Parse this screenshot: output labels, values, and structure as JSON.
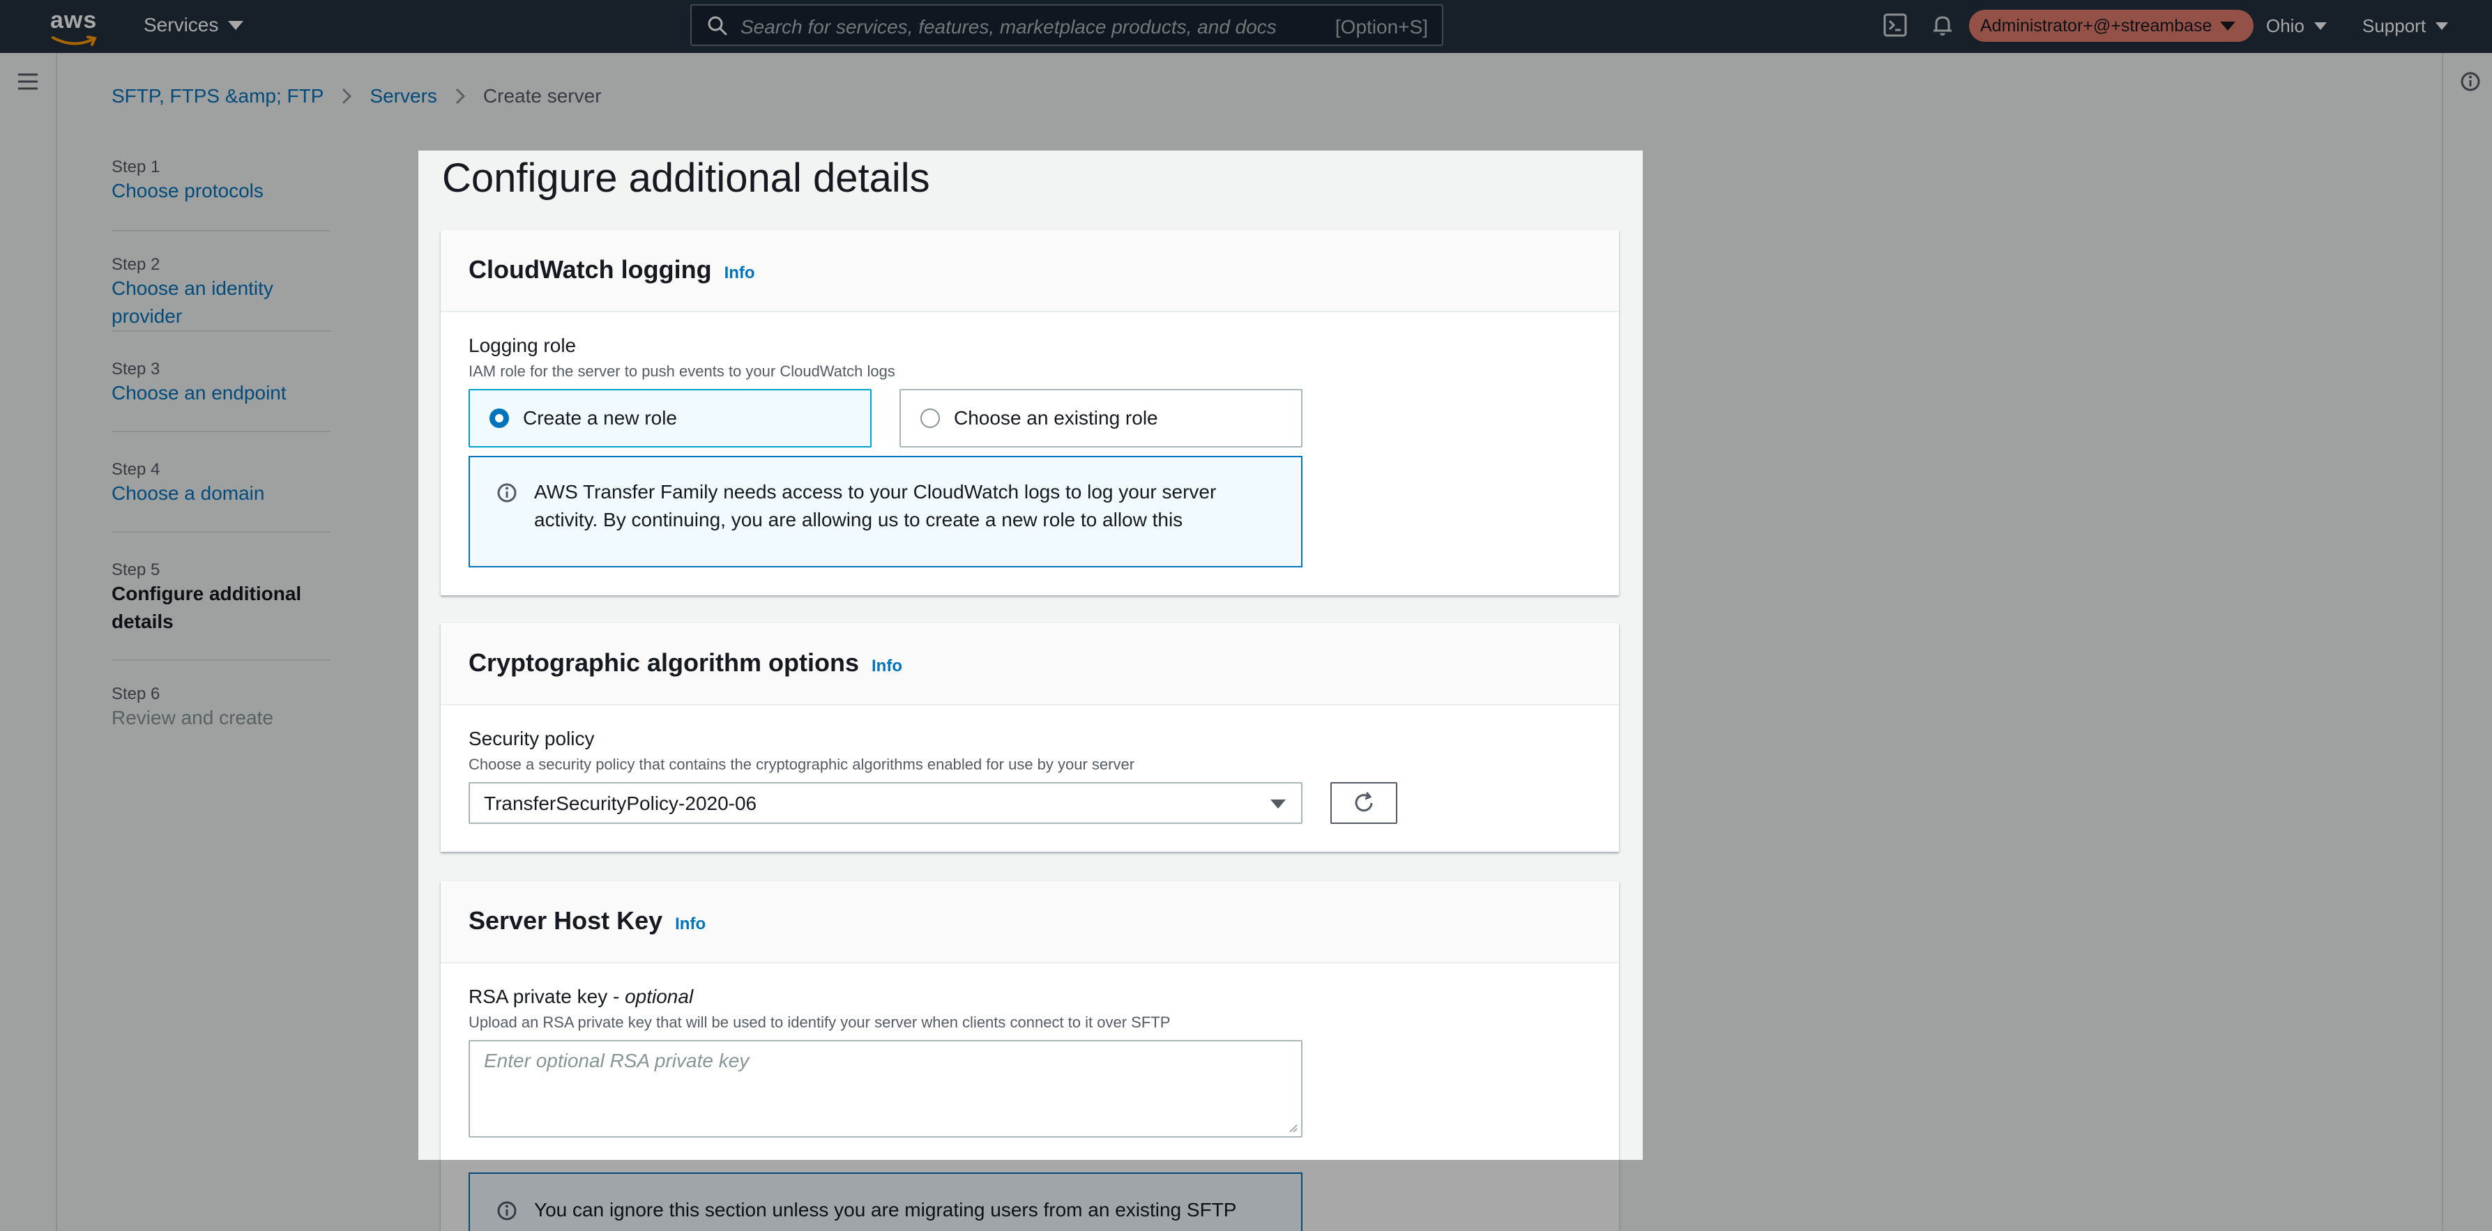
{
  "topnav": {
    "logo": "aws",
    "services_label": "Services",
    "search_placeholder": "Search for services, features, marketplace products, and docs",
    "search_shortcut": "[Option+S]",
    "user": "Administrator+@+streambase",
    "region": "Ohio",
    "support": "Support"
  },
  "breadcrumb": [
    "SFTP, FTPS &amp; FTP",
    "Servers",
    "Create server"
  ],
  "steps": [
    {
      "num": "Step 1",
      "label": "Choose protocols",
      "state": "link"
    },
    {
      "num": "Step 2",
      "label": "Choose an identity provider",
      "state": "link"
    },
    {
      "num": "Step 3",
      "label": "Choose an endpoint",
      "state": "link"
    },
    {
      "num": "Step 4",
      "label": "Choose a domain",
      "state": "link"
    },
    {
      "num": "Step 5",
      "label": "Configure additional details",
      "state": "current"
    },
    {
      "num": "Step 6",
      "label": "Review and create",
      "state": "disabled"
    }
  ],
  "page_title": "Configure additional details",
  "cloudwatch": {
    "title": "CloudWatch logging",
    "info": "Info",
    "field_label": "Logging role",
    "field_desc": "IAM role for the server to push events to your CloudWatch logs",
    "option_new": "Create a new role",
    "option_existing": "Choose an existing role",
    "alert": "AWS Transfer Family needs access to your CloudWatch logs to log your server activity. By continuing, you are allowing us to create a new role to allow this"
  },
  "crypto": {
    "title": "Cryptographic algorithm options",
    "info": "Info",
    "field_label": "Security policy",
    "field_desc": "Choose a security policy that contains the cryptographic algorithms enabled for use by your server",
    "selected": "TransferSecurityPolicy-2020-06"
  },
  "hostkey": {
    "title": "Server Host Key",
    "info": "Info",
    "field_label": "RSA private key - ",
    "field_label_optional": "optional",
    "field_desc": "Upload an RSA private key that will be used to identify your server when clients connect to it over SFTP",
    "placeholder": "Enter optional RSA private key",
    "alert": "You can ignore this section unless you are migrating users from an existing SFTP"
  },
  "colors": {
    "nav_bg": "#232f3e",
    "link": "#0073bb",
    "user_pill": "#e07b6e",
    "alert_border": "#0073bb",
    "alert_bg": "#f1faff"
  }
}
